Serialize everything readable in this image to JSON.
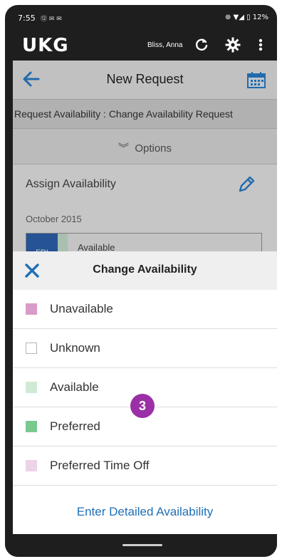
{
  "status_bar": {
    "time": "7:55",
    "mini_icons": "⑫ ✉ ✉",
    "right": "⊕ ▼◢ ▯ 12%"
  },
  "app_bar": {
    "logo": "UKG",
    "user_name": "Bliss, Anna",
    "icons": [
      "refresh-icon",
      "gear-icon",
      "menu-icon"
    ],
    "accent_color": "#4cc7c9"
  },
  "header": {
    "title": "New Request",
    "back_icon": "back-arrow-icon",
    "calendar_icon": "calendar-icon"
  },
  "request_bar": {
    "subtitle": "Request Availability : Change Availability Request",
    "options_label": "Options"
  },
  "assign_section": {
    "title": "Assign Availability",
    "month": "October 2015",
    "day_label": "FRI",
    "day_status": "Available"
  },
  "sheet": {
    "title": "Change Availability",
    "options": [
      {
        "label": "Unavailable",
        "color": "#d99bc8"
      },
      {
        "label": "Unknown",
        "color": "#ffffff"
      },
      {
        "label": "Available",
        "color": "#cfe9d6"
      },
      {
        "label": "Preferred",
        "color": "#7ac98f"
      },
      {
        "label": "Preferred Time Off",
        "color": "#ecd3e6"
      }
    ],
    "detailed_link": "Enter Detailed Availability"
  },
  "step_badge": "3"
}
